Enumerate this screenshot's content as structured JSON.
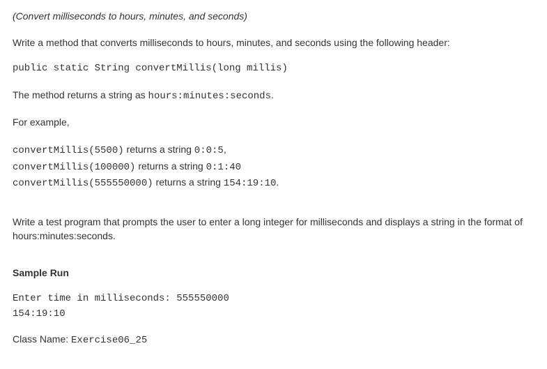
{
  "title": "(Convert milliseconds to hours, minutes, and seconds)",
  "intro": "Write a method that converts milliseconds to hours, minutes, and seconds using the following header:",
  "header_code": "public static String convertMillis(long millis)",
  "returns_prefix": "The method returns a string as ",
  "returns_format": "hours:minutes:seconds",
  "returns_suffix": ".",
  "for_example": "For example,",
  "example1_call": "convertMillis(5500)",
  "example1_mid": " returns a string ",
  "example1_result": "0:0:5",
  "example1_suffix": ",",
  "example2_call": "convertMillis(100000)",
  "example2_mid": "  returns a string ",
  "example2_result": "0:1:40",
  "example3_call": "convertMillis(555550000)",
  "example3_mid": "  returns a string ",
  "example3_result": "154:19:10",
  "example3_suffix": ".",
  "instruction": "Write a test program that prompts the user to enter a long integer for milliseconds and displays a string in the format of hours:minutes:seconds.",
  "sample_run_title": "Sample Run",
  "sample_run": "Enter time in milliseconds: 555550000\n154:19:10",
  "class_name_label": "Class Name: ",
  "class_name_value": "Exercise06_25"
}
